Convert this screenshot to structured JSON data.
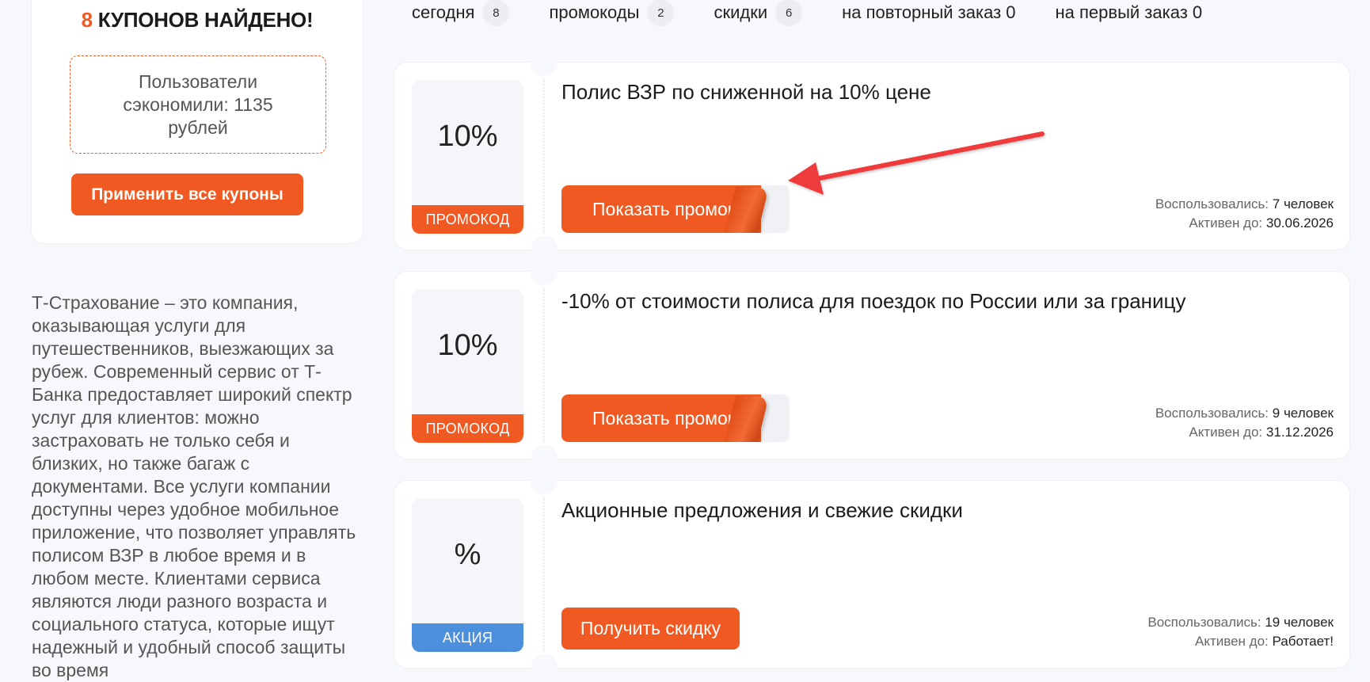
{
  "sidebar": {
    "found_count": "8",
    "found_text": "КУПОНОВ НАЙДЕНО!",
    "saved_text": "Пользователи сэкономили: 1135 рублей",
    "apply_all_label": "Применить все купоны",
    "description": "Т-Страхование – это компания, оказывающая услуги для путешественников, выезжающих за рубеж. Современный сервис от Т-Банка предоставляет широкий спектр услуг для клиентов: можно застраховать не только себя и близких, но также багаж с документами. Все услуги компании доступны через удобное мобильное приложение, что позволяет управлять полисом ВЗР в любое время и в любом месте. Клиентами сервиса являются люди разного возраста и социального статуса, которые ищут надежный и удобный способ защиты во время"
  },
  "filters": [
    {
      "label": "сегодня",
      "count": "8"
    },
    {
      "label": "промокоды",
      "count": "2"
    },
    {
      "label": "скидки",
      "count": "6"
    },
    {
      "label": "на повторный заказ 0"
    },
    {
      "label": "на первый заказ 0"
    }
  ],
  "coupons": [
    {
      "value": "10%",
      "type_label": "ПРОМОКОД",
      "title": "Полис ВЗР по сниженной на 10% цене",
      "button_label": "Показать промокод",
      "used_label": "Воспользовались:",
      "used_value": "7 человек",
      "active_label": "Активен до:",
      "active_value": "30.06.2026"
    },
    {
      "value": "10%",
      "type_label": "ПРОМОКОД",
      "title": "-10% от стоимости полиса для поездок по России или за границу",
      "button_label": "Показать промокод",
      "used_label": "Воспользовались:",
      "used_value": "9 человек",
      "active_label": "Активен до:",
      "active_value": "31.12.2026"
    },
    {
      "value": "%",
      "type_label": "АКЦИЯ",
      "title": "Акционные предложения и свежие скидки",
      "button_label": "Получить скидку",
      "used_label": "Воспользовались:",
      "used_value": "19 человек",
      "active_label": "Активен до:",
      "active_value": "Работает!"
    }
  ],
  "colors": {
    "accent": "#f05a22",
    "promo_badge": "#f05a22",
    "action_badge": "#4c8fdc",
    "annotation_arrow": "#ee3b3b"
  }
}
